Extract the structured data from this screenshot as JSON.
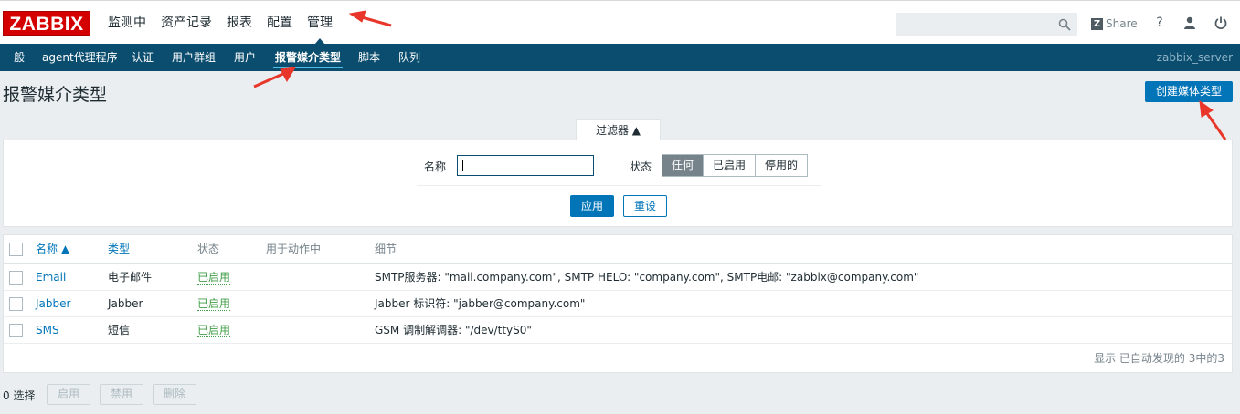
{
  "logo": "ZABBIX",
  "main_menu": [
    "监测中",
    "资产记录",
    "报表",
    "配置",
    "管理"
  ],
  "search": {
    "placeholder": ""
  },
  "header": {
    "share_label": "Share",
    "share_z": "Z",
    "help": "?",
    "user": "👤",
    "power": "⏻"
  },
  "sub_menu": [
    "一般",
    "agent代理程序",
    "认证",
    "用户群组",
    "用户",
    "报警媒介类型",
    "脚本",
    "队列"
  ],
  "server_name": "zabbix_server",
  "page": {
    "title": "报警媒介类型",
    "create_button": "创建媒体类型"
  },
  "filter": {
    "tab_label": "过滤器 ▲",
    "name_label": "名称",
    "name_value": "",
    "status_label": "状态",
    "status_options": [
      "任何",
      "已启用",
      "停用的"
    ],
    "status_selected": "任何",
    "apply": "应用",
    "reset": "重设"
  },
  "table": {
    "headers": {
      "name": "名称 ▲",
      "type": "类型",
      "status": "状态",
      "used_in_actions": "用于动作中",
      "details": "细节"
    },
    "rows": [
      {
        "name": "Email",
        "type": "电子邮件",
        "status": "已启用",
        "used": "",
        "details": "SMTP服务器: \"mail.company.com\", SMTP HELO: \"company.com\", SMTP电邮: \"zabbix@company.com\""
      },
      {
        "name": "Jabber",
        "type": "Jabber",
        "status": "已启用",
        "used": "",
        "details": "Jabber 标识符: \"jabber@company.com\""
      },
      {
        "name": "SMS",
        "type": "短信",
        "status": "已启用",
        "used": "",
        "details": "GSM 调制解调器: \"/dev/ttyS0\""
      }
    ],
    "footer": "显示 已自动发现的 3中的3"
  },
  "bulk": {
    "selected": "0 选择",
    "enable": "启用",
    "disable": "禁用",
    "delete": "删除"
  },
  "colors": {
    "brand": "#d40000",
    "nav": "#0b4d6e",
    "primary": "#0275b8",
    "enabled": "#429e47",
    "annotation": "#e8372a"
  }
}
